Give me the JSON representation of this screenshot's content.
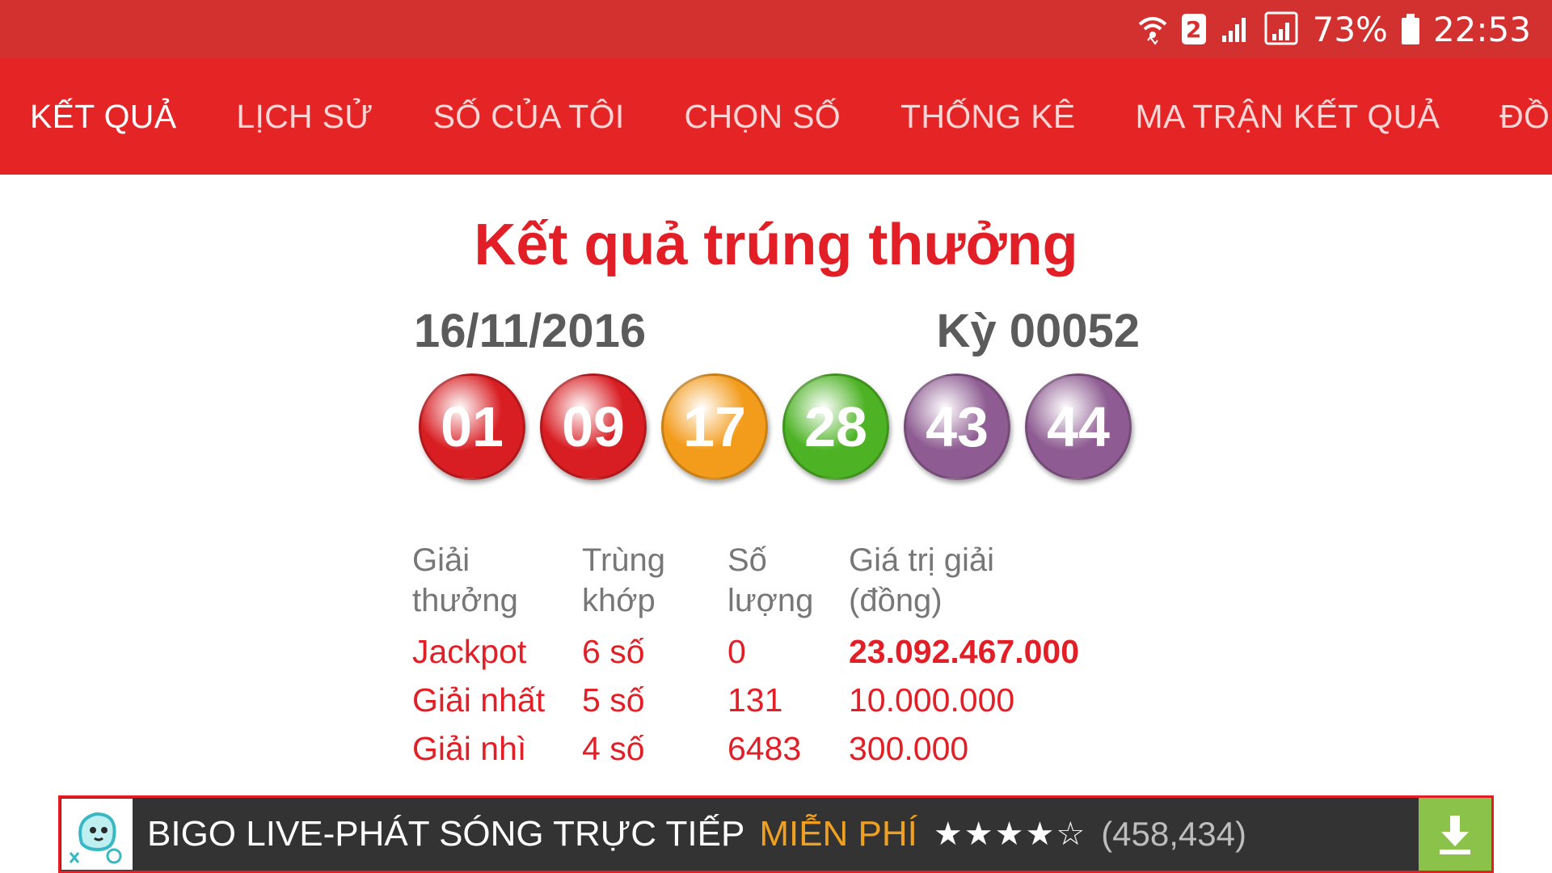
{
  "status_bar": {
    "sim_slot": "2",
    "battery_percent": "73%",
    "time": "22:53"
  },
  "tabs": [
    {
      "label": "KẾT QUẢ",
      "active": true
    },
    {
      "label": "LỊCH SỬ",
      "active": false
    },
    {
      "label": "SỐ CỦA TÔI",
      "active": false
    },
    {
      "label": "CHỌN SỐ",
      "active": false
    },
    {
      "label": "THỐNG KÊ",
      "active": false
    },
    {
      "label": "MA TRẬN KẾT QUẢ",
      "active": false
    },
    {
      "label": "ĐỒ THỊ C",
      "active": false
    }
  ],
  "result": {
    "title": "Kết quả trúng thưởng",
    "date": "16/11/2016",
    "draw": "Kỳ 00052",
    "balls": [
      {
        "number": "01",
        "color": "#d81e23"
      },
      {
        "number": "09",
        "color": "#d81e23"
      },
      {
        "number": "17",
        "color": "#f39b1b"
      },
      {
        "number": "28",
        "color": "#4db324"
      },
      {
        "number": "43",
        "color": "#8e5c92"
      },
      {
        "number": "44",
        "color": "#8e5c92"
      }
    ]
  },
  "prize_table": {
    "headers": {
      "prize_l1": "Giải",
      "prize_l2": "thưởng",
      "match_l1": "Trùng",
      "match_l2": "khớp",
      "count_l1": "Số",
      "count_l2": "lượng",
      "value_l1": "Giá trị giải",
      "value_l2": "(đồng)"
    },
    "rows": [
      {
        "prize": "Jackpot",
        "match": "6 số",
        "count": "0",
        "value": "23.092.467.000"
      },
      {
        "prize": "Giải nhất",
        "match": "5 số",
        "count": "131",
        "value": "10.000.000"
      },
      {
        "prize": "Giải nhì",
        "match": "4 số",
        "count": "6483",
        "value": "300.000"
      }
    ]
  },
  "ad": {
    "title": "BIGO LIVE-PHÁT SÓNG TRỰC TIẾP",
    "free": "MIỄN PHÍ",
    "stars": "★★★★☆",
    "reviews": "(458,434)"
  }
}
